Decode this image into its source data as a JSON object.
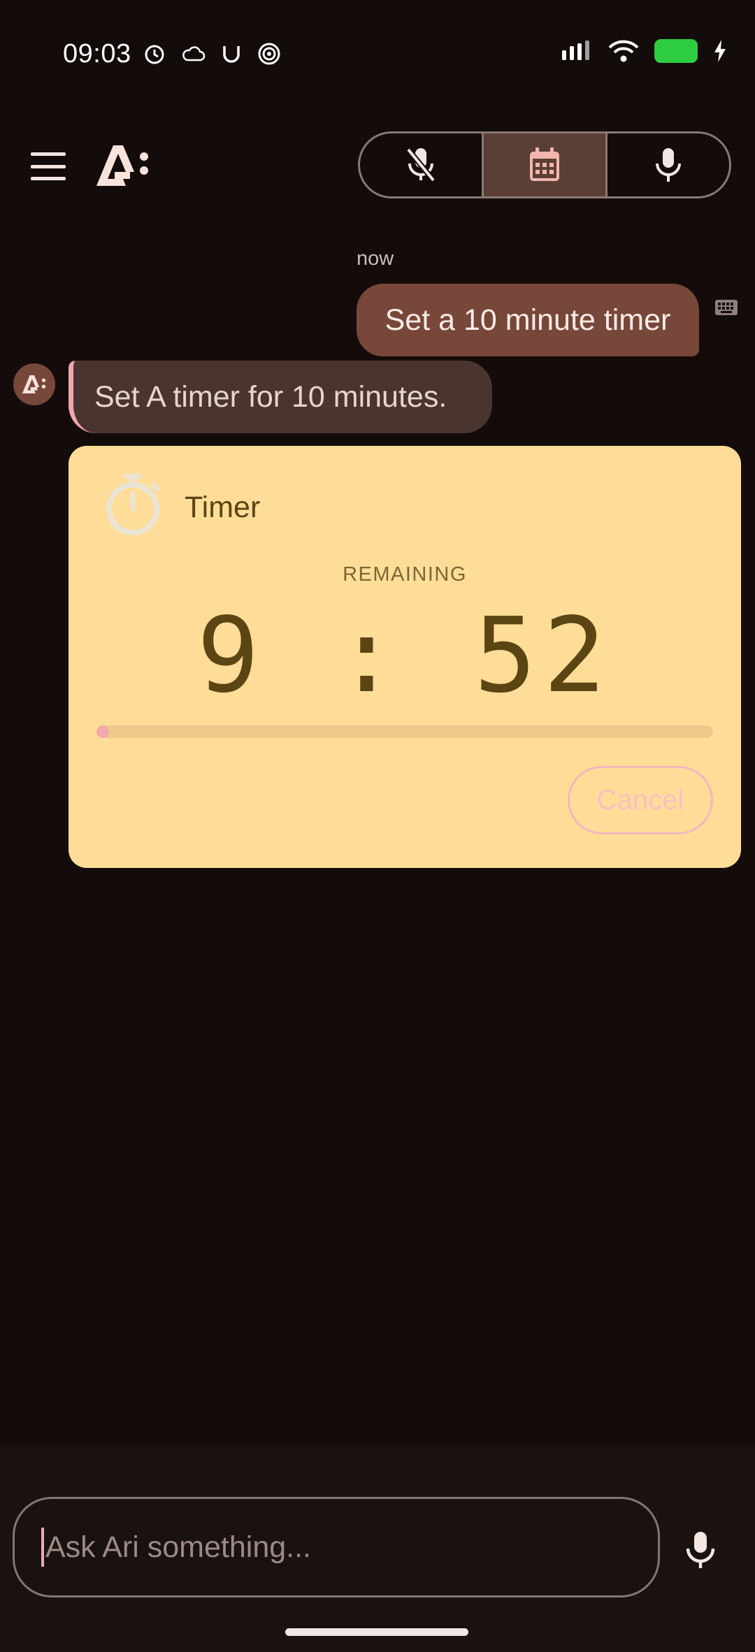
{
  "status_bar": {
    "time": "09:03",
    "left_icons": [
      "alarm-icon",
      "cloud-icon",
      "u-icon",
      "spiral-icon"
    ],
    "right_icons": [
      "signal-icon",
      "wifi-icon",
      "battery-charging-icon"
    ],
    "battery_color": "#2ecc40"
  },
  "header": {
    "menu_icon": "hamburger-icon",
    "logo": "ari-logo",
    "mode_buttons": [
      {
        "icon": "mic-off-icon",
        "active": false
      },
      {
        "icon": "calendar-icon",
        "active": true
      },
      {
        "icon": "mic-icon",
        "active": false
      }
    ]
  },
  "chat": {
    "timestamp": "now",
    "user_message": "Set a 10 minute timer",
    "bot_message": "Set A timer for 10 minutes."
  },
  "timer_card": {
    "title": "Timer",
    "remaining_label": "REMAINING",
    "countdown": "9 : 52",
    "progress_fraction": 0.013,
    "cancel_label": "Cancel",
    "background": "#ffdd98"
  },
  "input": {
    "placeholder": "Ask Ari something..."
  },
  "colors": {
    "background": "#130c0b",
    "user_bubble": "#77473a",
    "bot_bubble": "#4a3430",
    "accent_pink": "#f4a8ad"
  }
}
